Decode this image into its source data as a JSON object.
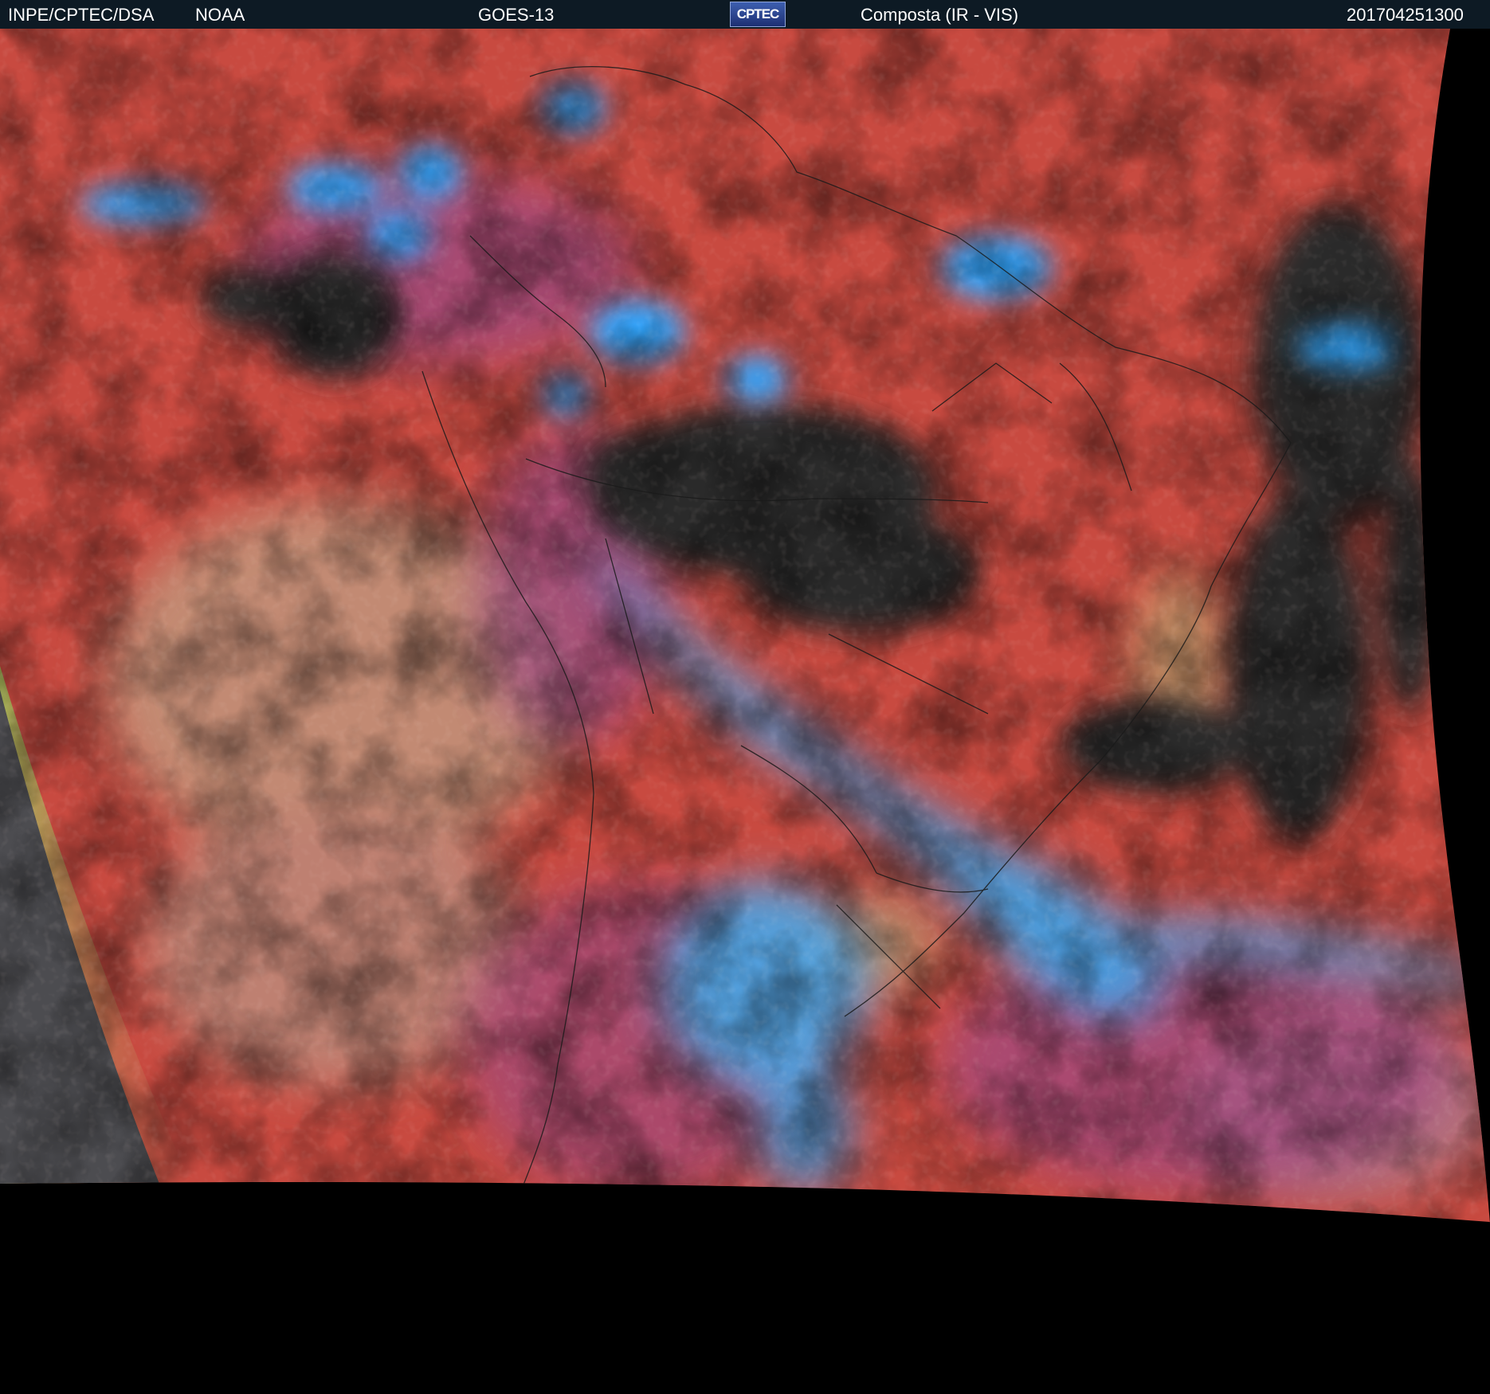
{
  "header": {
    "agency": "INPE/CPTEC/DSA",
    "partner": "NOAA",
    "satellite": "GOES-13",
    "logo_text": "CPTEC",
    "product": "Composta (IR - VIS)",
    "timestamp": "201704251300"
  },
  "colors": {
    "header_bg": "#0d1a24",
    "clear_land": "#c84a40",
    "cold_cloud": "#2ea6ff",
    "low_cloud": "#b89a7a",
    "background": "#000000"
  }
}
